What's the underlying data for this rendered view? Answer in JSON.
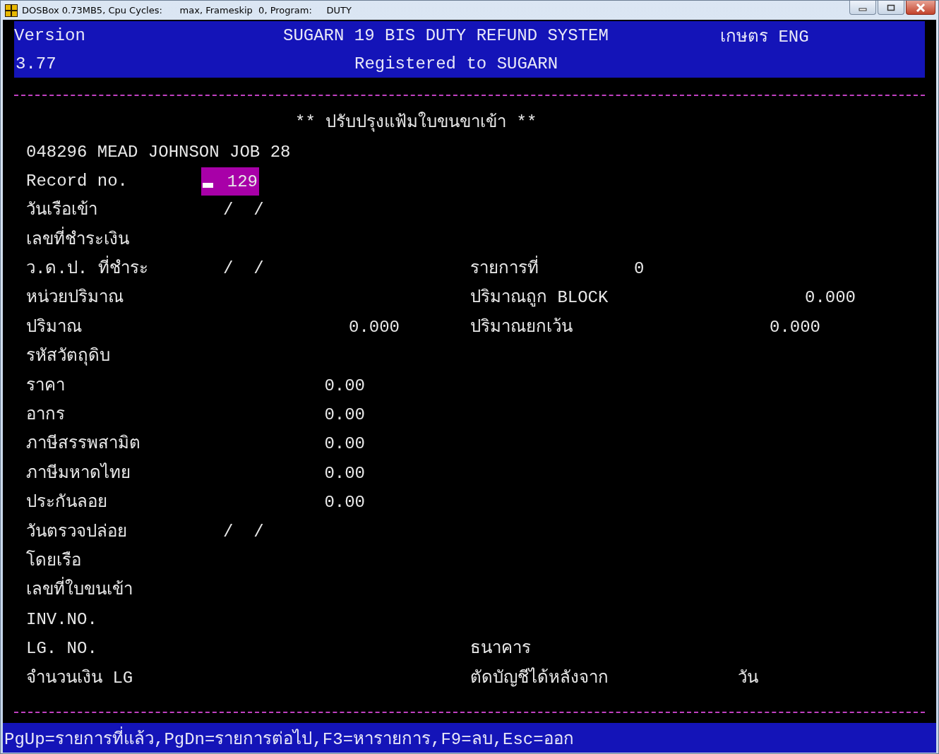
{
  "window": {
    "title": "DOSBox 0.73MB5, Cpu Cycles:      max, Frameskip  0, Program:     DUTY"
  },
  "header": {
    "version_label": "Version",
    "version": "3.77",
    "title": "SUGARN 19 BIS DUTY REFUND SYSTEM",
    "language": "เกษตร ENG",
    "registration": "Registered to SUGARN"
  },
  "form": {
    "title": "** ปรับปรุงแฟ้มใบขนขาเข้า **",
    "company": "048296 MEAD JOHNSON JOB 28",
    "rows": [
      {
        "left": {
          "label": "Record no.",
          "kind": "input",
          "value": "129",
          "focused": true
        }
      },
      {
        "left": {
          "label": "วันเรือเข้า",
          "kind": "date",
          "value": "/  /"
        }
      },
      {
        "left": {
          "label": "เลขที่ชำระเงิน",
          "kind": "blank"
        }
      },
      {
        "left": {
          "label": "ว.ด.ป. ที่ชำระ",
          "kind": "date",
          "value": "/  /"
        },
        "right": {
          "label": "รายการที่",
          "kind": "count",
          "value": "0"
        }
      },
      {
        "left": {
          "label": "หน่วยปริมาณ",
          "kind": "blank"
        },
        "right": {
          "label": "ปริมาณถูก BLOCK",
          "kind": "wide",
          "value": "0.000"
        }
      },
      {
        "left": {
          "label": "ปริมาณ",
          "kind": "qty",
          "value": "0.000"
        },
        "right": {
          "label": "ปริมาณยกเว้น",
          "kind": "number",
          "value": "0.000"
        }
      },
      {
        "left": {
          "label": "รหัสวัตถุดิบ",
          "kind": "blank"
        }
      },
      {
        "left": {
          "label": "ราคา",
          "kind": "money",
          "value": "0.00"
        }
      },
      {
        "left": {
          "label": "อากร",
          "kind": "money",
          "value": "0.00"
        }
      },
      {
        "left": {
          "label": "ภาษีสรรพสามิต",
          "kind": "money",
          "value": "0.00"
        }
      },
      {
        "left": {
          "label": "ภาษีมหาดไทย",
          "kind": "money",
          "value": "0.00"
        }
      },
      {
        "left": {
          "label": "ประกันลอย",
          "kind": "money",
          "value": "0.00"
        }
      },
      {
        "left": {
          "label": "วันตรวจปล่อย",
          "kind": "date",
          "value": "/  /"
        }
      },
      {
        "left": {
          "label": "โดยเรือ",
          "kind": "blank"
        }
      },
      {
        "left": {
          "label": "เลขที่ใบขนเข้า",
          "kind": "blank"
        }
      },
      {
        "left": {
          "label": "INV.NO.",
          "kind": "blank"
        }
      },
      {
        "left": {
          "label": "LG. NO.",
          "kind": "blank"
        },
        "right": {
          "label": "ธนาคาร",
          "kind": "blank"
        }
      },
      {
        "left": {
          "label": "จำนวนเงิน LG",
          "kind": "blank"
        },
        "right": {
          "label": "ตัดบัญชีได้หลังจาก",
          "kind": "unit",
          "value": "วัน"
        }
      }
    ]
  },
  "status_bar": "PgUp=รายการที่แล้ว,PgDn=รายการต่อไป,F3=หารายการ,F9=ลบ,Esc=ออก"
}
